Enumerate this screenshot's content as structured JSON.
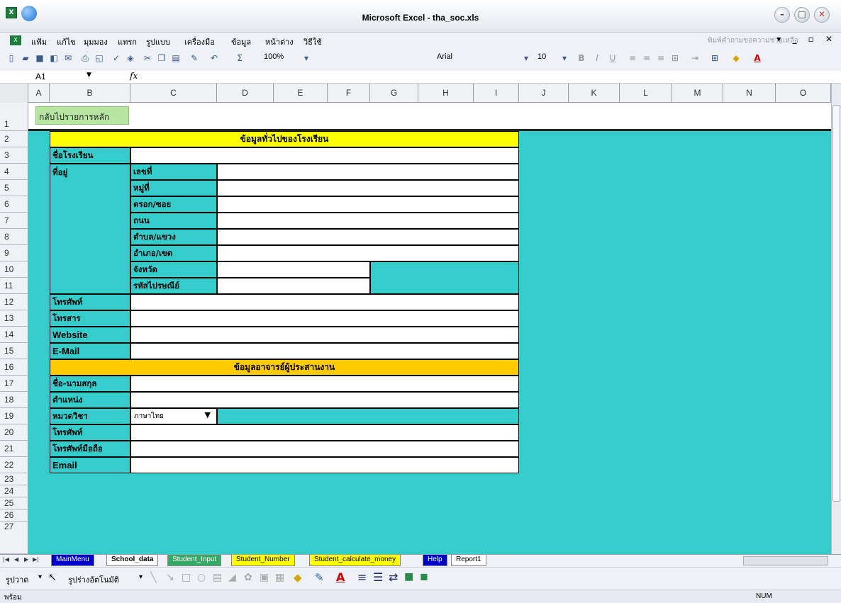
{
  "window": {
    "title": "Microsoft Excel - tha_soc.xls"
  },
  "menu": {
    "items": [
      "แฟ้ม",
      "แก้ไข",
      "มุมมอง",
      "แทรก",
      "รูปแบบ",
      "เครื่องมือ",
      "ข้อมูล",
      "หน้าต่าง",
      "วิธีใช้"
    ],
    "help_search_placeholder": "พิมพ์คำถามขอความช่วยเหลือ"
  },
  "toolbar": {
    "zoom": "100%",
    "font_name": "Arial",
    "font_size": "10"
  },
  "formula_bar": {
    "name_box": "A1",
    "fx": "fx"
  },
  "columns": [
    "A",
    "B",
    "C",
    "D",
    "E",
    "F",
    "G",
    "H",
    "I",
    "J",
    "K",
    "L",
    "M",
    "N",
    "O"
  ],
  "rows": [
    "1",
    "2",
    "3",
    "4",
    "5",
    "6",
    "7",
    "8",
    "9",
    "10",
    "11",
    "12",
    "13",
    "14",
    "15",
    "16",
    "17",
    "18",
    "19",
    "20",
    "21",
    "22",
    "23",
    "24",
    "25",
    "26",
    "27"
  ],
  "back_button": "กลับไปรายการหลัก",
  "form": {
    "section1_title": "ข้อมูลทั่วไปของโรงเรียน",
    "school_name": "ชื่อโรงเรียน",
    "address": "ที่อยู่",
    "addr_number": "เลขที่",
    "addr_moo": "หมู่ที่",
    "addr_soi": "ตรอก/ซอย",
    "addr_road": "ถนน",
    "addr_tambon": "ตำบล/แขวง",
    "addr_amphoe": "อำเภอ/เขต",
    "addr_province": "จังหวัด",
    "addr_postcode": "รหัสไปรษณีย์",
    "phone": "โทรศัพท์",
    "fax": "โทรสาร",
    "website": "Website",
    "email": "E-Mail",
    "section2_title": "ข้อมูลอาจารย์ผู้ประสานงาน",
    "teacher_name": "ชื่อ-นามสกุล",
    "position": "ตำแหน่ง",
    "subject": "หมวดวิชา",
    "subject_value": "ภาษาไทย",
    "teacher_phone": "โทรศัพท์",
    "mobile": "โทรศัพท์มือถือ",
    "teacher_email": "Email"
  },
  "sheet_tabs": [
    "MainMenu",
    "School_data",
    "Student_Input",
    "Student_Number",
    "Student_calculate_money",
    "Help",
    "Report1"
  ],
  "drawing_toolbar": {
    "draw_label": "รูปวาด",
    "autoshapes_label": "รูปร่างอัตโนมัติ"
  },
  "status": {
    "text": "พร้อม",
    "num": "NUM"
  },
  "colors": {
    "sheet_bg": "#35cccc",
    "section1_bg": "#ffff00",
    "section2_bg": "#ffcc00",
    "back_button_bg": "#b6e6a0"
  }
}
